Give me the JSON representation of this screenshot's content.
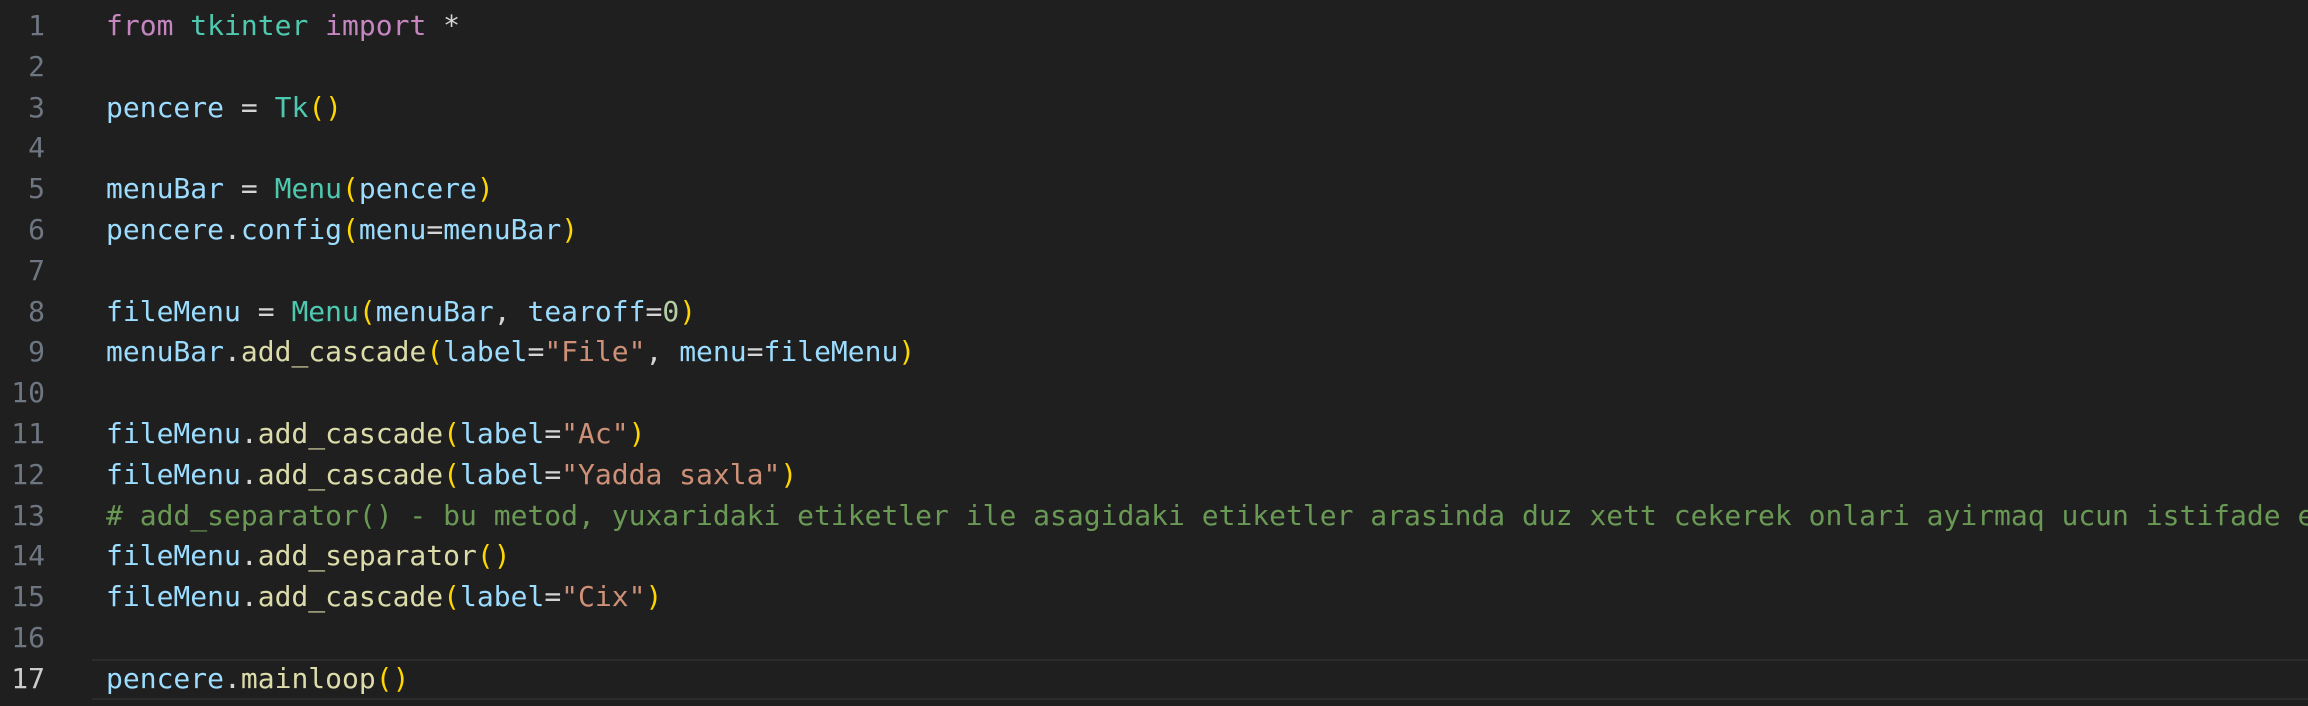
{
  "colors": {
    "background": "#1f1f1f",
    "line_number": "#6e7681",
    "keyword": "#c586c0",
    "module": "#4ec9b0",
    "variable": "#9cdcfe",
    "function": "#dcdcaa",
    "bracket": "#ffd700",
    "string": "#ce9178",
    "number": "#b5cea8",
    "comment": "#6a9955"
  },
  "editor": {
    "current_line": 17,
    "lines": [
      {
        "n": "1",
        "tokens": [
          [
            "kw",
            "from"
          ],
          [
            "op",
            " "
          ],
          [
            "mod",
            "tkinter"
          ],
          [
            "op",
            " "
          ],
          [
            "kw",
            "import"
          ],
          [
            "op",
            " *"
          ]
        ]
      },
      {
        "n": "2",
        "tokens": []
      },
      {
        "n": "3",
        "tokens": [
          [
            "var",
            "pencere"
          ],
          [
            "op",
            " = "
          ],
          [
            "cls",
            "Tk"
          ],
          [
            "br",
            "()"
          ]
        ]
      },
      {
        "n": "4",
        "tokens": []
      },
      {
        "n": "5",
        "tokens": [
          [
            "var",
            "menuBar"
          ],
          [
            "op",
            " = "
          ],
          [
            "cls",
            "Menu"
          ],
          [
            "br",
            "("
          ],
          [
            "var",
            "pencere"
          ],
          [
            "br",
            ")"
          ]
        ]
      },
      {
        "n": "6",
        "tokens": [
          [
            "var",
            "pencere"
          ],
          [
            "op",
            "."
          ],
          [
            "var",
            "config"
          ],
          [
            "br",
            "("
          ],
          [
            "var",
            "menu"
          ],
          [
            "op",
            "="
          ],
          [
            "var",
            "menuBar"
          ],
          [
            "br",
            ")"
          ]
        ]
      },
      {
        "n": "7",
        "tokens": []
      },
      {
        "n": "8",
        "tokens": [
          [
            "var",
            "fileMenu"
          ],
          [
            "op",
            " = "
          ],
          [
            "cls",
            "Menu"
          ],
          [
            "br",
            "("
          ],
          [
            "var",
            "menuBar"
          ],
          [
            "op",
            ", "
          ],
          [
            "var",
            "tearoff"
          ],
          [
            "op",
            "="
          ],
          [
            "num",
            "0"
          ],
          [
            "br",
            ")"
          ]
        ]
      },
      {
        "n": "9",
        "tokens": [
          [
            "var",
            "menuBar"
          ],
          [
            "op",
            "."
          ],
          [
            "fn",
            "add_cascade"
          ],
          [
            "br",
            "("
          ],
          [
            "var",
            "label"
          ],
          [
            "op",
            "="
          ],
          [
            "str",
            "\"File\""
          ],
          [
            "op",
            ", "
          ],
          [
            "var",
            "menu"
          ],
          [
            "op",
            "="
          ],
          [
            "var",
            "fileMenu"
          ],
          [
            "br",
            ")"
          ]
        ]
      },
      {
        "n": "10",
        "tokens": []
      },
      {
        "n": "11",
        "tokens": [
          [
            "var",
            "fileMenu"
          ],
          [
            "op",
            "."
          ],
          [
            "fn",
            "add_cascade"
          ],
          [
            "br",
            "("
          ],
          [
            "var",
            "label"
          ],
          [
            "op",
            "="
          ],
          [
            "str",
            "\"Ac\""
          ],
          [
            "br",
            ")"
          ]
        ]
      },
      {
        "n": "12",
        "tokens": [
          [
            "var",
            "fileMenu"
          ],
          [
            "op",
            "."
          ],
          [
            "fn",
            "add_cascade"
          ],
          [
            "br",
            "("
          ],
          [
            "var",
            "label"
          ],
          [
            "op",
            "="
          ],
          [
            "str",
            "\"Yadda saxla\""
          ],
          [
            "br",
            ")"
          ]
        ]
      },
      {
        "n": "13",
        "tokens": [
          [
            "cm",
            "# add_separator() - bu metod, yuxaridaki etiketler ile asagidaki etiketler arasinda duz xett cekerek onlari ayirmaq ucun istifade edilir."
          ]
        ]
      },
      {
        "n": "14",
        "tokens": [
          [
            "var",
            "fileMenu"
          ],
          [
            "op",
            "."
          ],
          [
            "fn",
            "add_separator"
          ],
          [
            "br",
            "()"
          ]
        ]
      },
      {
        "n": "15",
        "tokens": [
          [
            "var",
            "fileMenu"
          ],
          [
            "op",
            "."
          ],
          [
            "fn",
            "add_cascade"
          ],
          [
            "br",
            "("
          ],
          [
            "var",
            "label"
          ],
          [
            "op",
            "="
          ],
          [
            "str",
            "\"Cix\""
          ],
          [
            "br",
            ")"
          ]
        ]
      },
      {
        "n": "16",
        "tokens": []
      },
      {
        "n": "17",
        "tokens": [
          [
            "var",
            "pencere"
          ],
          [
            "op",
            "."
          ],
          [
            "fn",
            "mainloop"
          ],
          [
            "br",
            "()"
          ]
        ]
      }
    ]
  }
}
